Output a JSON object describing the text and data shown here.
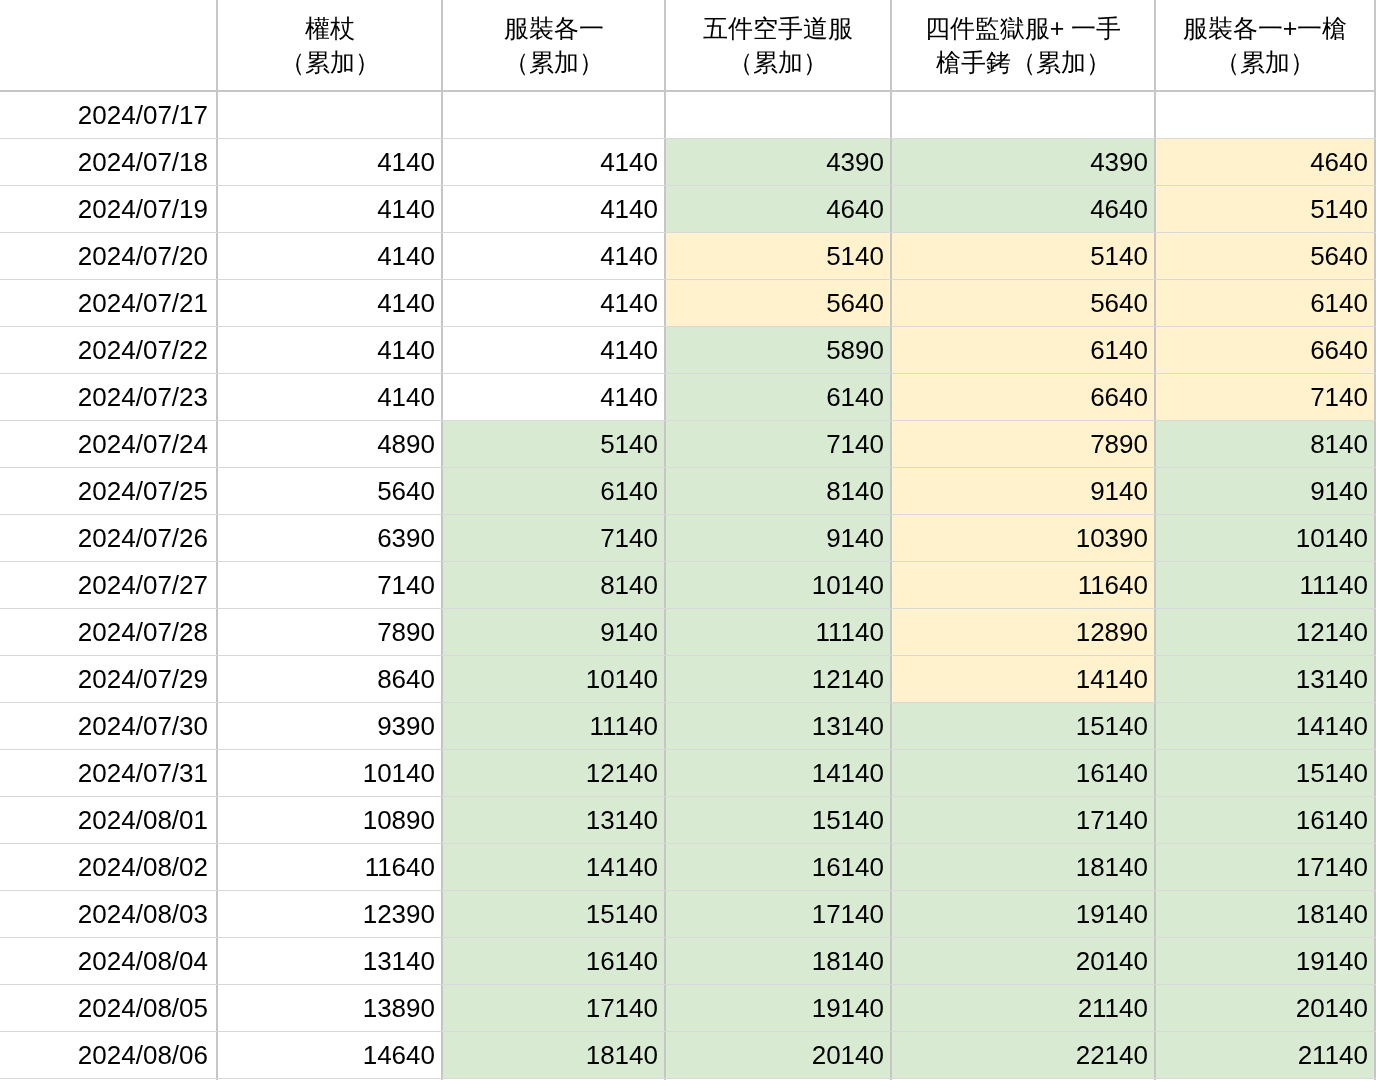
{
  "columns": [
    {
      "lines": [
        "權杖",
        "（累加）"
      ]
    },
    {
      "lines": [
        "服裝各一",
        "（累加）"
      ]
    },
    {
      "lines": [
        "五件空手道服",
        "（累加）"
      ]
    },
    {
      "lines": [
        "四件監獄服+ 一手",
        "槍手銬（累加）"
      ]
    },
    {
      "lines": [
        "服裝各一+一槍",
        "（累加）"
      ]
    }
  ],
  "rows": [
    {
      "date": "2024/07/17",
      "cells": [
        {},
        {},
        {},
        {},
        {}
      ]
    },
    {
      "date": "2024/07/18",
      "cells": [
        {
          "value": "4140"
        },
        {
          "value": "4140"
        },
        {
          "value": "4390",
          "color": "#d9ead3"
        },
        {
          "value": "4390",
          "color": "#d9ead3"
        },
        {
          "value": "4640",
          "color": "#fff2cc"
        }
      ]
    },
    {
      "date": "2024/07/19",
      "cells": [
        {
          "value": "4140"
        },
        {
          "value": "4140"
        },
        {
          "value": "4640",
          "color": "#d9ead3"
        },
        {
          "value": "4640",
          "color": "#d9ead3"
        },
        {
          "value": "5140",
          "color": "#fff2cc"
        }
      ]
    },
    {
      "date": "2024/07/20",
      "cells": [
        {
          "value": "4140"
        },
        {
          "value": "4140"
        },
        {
          "value": "5140",
          "color": "#fff2cc"
        },
        {
          "value": "5140",
          "color": "#fff2cc"
        },
        {
          "value": "5640",
          "color": "#fff2cc"
        }
      ]
    },
    {
      "date": "2024/07/21",
      "cells": [
        {
          "value": "4140"
        },
        {
          "value": "4140"
        },
        {
          "value": "5640",
          "color": "#fff2cc"
        },
        {
          "value": "5640",
          "color": "#fff2cc"
        },
        {
          "value": "6140",
          "color": "#fff2cc"
        }
      ]
    },
    {
      "date": "2024/07/22",
      "cells": [
        {
          "value": "4140"
        },
        {
          "value": "4140"
        },
        {
          "value": "5890",
          "color": "#d9ead3"
        },
        {
          "value": "6140",
          "color": "#fff2cc"
        },
        {
          "value": "6640",
          "color": "#fff2cc"
        }
      ]
    },
    {
      "date": "2024/07/23",
      "cells": [
        {
          "value": "4140"
        },
        {
          "value": "4140"
        },
        {
          "value": "6140",
          "color": "#d9ead3"
        },
        {
          "value": "6640",
          "color": "#fff2cc"
        },
        {
          "value": "7140",
          "color": "#fff2cc"
        }
      ]
    },
    {
      "date": "2024/07/24",
      "cells": [
        {
          "value": "4890"
        },
        {
          "value": "5140",
          "color": "#d9ead3"
        },
        {
          "value": "7140",
          "color": "#d9ead3"
        },
        {
          "value": "7890",
          "color": "#fff2cc"
        },
        {
          "value": "8140",
          "color": "#d9ead3"
        }
      ]
    },
    {
      "date": "2024/07/25",
      "cells": [
        {
          "value": "5640"
        },
        {
          "value": "6140",
          "color": "#d9ead3"
        },
        {
          "value": "8140",
          "color": "#d9ead3"
        },
        {
          "value": "9140",
          "color": "#fff2cc"
        },
        {
          "value": "9140",
          "color": "#d9ead3"
        }
      ]
    },
    {
      "date": "2024/07/26",
      "cells": [
        {
          "value": "6390"
        },
        {
          "value": "7140",
          "color": "#d9ead3"
        },
        {
          "value": "9140",
          "color": "#d9ead3"
        },
        {
          "value": "10390",
          "color": "#fff2cc"
        },
        {
          "value": "10140",
          "color": "#d9ead3"
        }
      ]
    },
    {
      "date": "2024/07/27",
      "cells": [
        {
          "value": "7140"
        },
        {
          "value": "8140",
          "color": "#d9ead3"
        },
        {
          "value": "10140",
          "color": "#d9ead3"
        },
        {
          "value": "11640",
          "color": "#fff2cc"
        },
        {
          "value": "11140",
          "color": "#d9ead3"
        }
      ]
    },
    {
      "date": "2024/07/28",
      "cells": [
        {
          "value": "7890"
        },
        {
          "value": "9140",
          "color": "#d9ead3"
        },
        {
          "value": "11140",
          "color": "#d9ead3"
        },
        {
          "value": "12890",
          "color": "#fff2cc"
        },
        {
          "value": "12140",
          "color": "#d9ead3"
        }
      ]
    },
    {
      "date": "2024/07/29",
      "cells": [
        {
          "value": "8640"
        },
        {
          "value": "10140",
          "color": "#d9ead3"
        },
        {
          "value": "12140",
          "color": "#d9ead3"
        },
        {
          "value": "14140",
          "color": "#fff2cc"
        },
        {
          "value": "13140",
          "color": "#d9ead3"
        }
      ]
    },
    {
      "date": "2024/07/30",
      "cells": [
        {
          "value": "9390"
        },
        {
          "value": "11140",
          "color": "#d9ead3"
        },
        {
          "value": "13140",
          "color": "#d9ead3"
        },
        {
          "value": "15140",
          "color": "#d9ead3"
        },
        {
          "value": "14140",
          "color": "#d9ead3"
        }
      ]
    },
    {
      "date": "2024/07/31",
      "cells": [
        {
          "value": "10140"
        },
        {
          "value": "12140",
          "color": "#d9ead3"
        },
        {
          "value": "14140",
          "color": "#d9ead3"
        },
        {
          "value": "16140",
          "color": "#d9ead3"
        },
        {
          "value": "15140",
          "color": "#d9ead3"
        }
      ]
    },
    {
      "date": "2024/08/01",
      "cells": [
        {
          "value": "10890"
        },
        {
          "value": "13140",
          "color": "#d9ead3"
        },
        {
          "value": "15140",
          "color": "#d9ead3"
        },
        {
          "value": "17140",
          "color": "#d9ead3"
        },
        {
          "value": "16140",
          "color": "#d9ead3"
        }
      ]
    },
    {
      "date": "2024/08/02",
      "cells": [
        {
          "value": "11640"
        },
        {
          "value": "14140",
          "color": "#d9ead3"
        },
        {
          "value": "16140",
          "color": "#d9ead3"
        },
        {
          "value": "18140",
          "color": "#d9ead3"
        },
        {
          "value": "17140",
          "color": "#d9ead3"
        }
      ]
    },
    {
      "date": "2024/08/03",
      "cells": [
        {
          "value": "12390"
        },
        {
          "value": "15140",
          "color": "#d9ead3"
        },
        {
          "value": "17140",
          "color": "#d9ead3"
        },
        {
          "value": "19140",
          "color": "#d9ead3"
        },
        {
          "value": "18140",
          "color": "#d9ead3"
        }
      ]
    },
    {
      "date": "2024/08/04",
      "cells": [
        {
          "value": "13140"
        },
        {
          "value": "16140",
          "color": "#d9ead3"
        },
        {
          "value": "18140",
          "color": "#d9ead3"
        },
        {
          "value": "20140",
          "color": "#d9ead3"
        },
        {
          "value": "19140",
          "color": "#d9ead3"
        }
      ]
    },
    {
      "date": "2024/08/05",
      "cells": [
        {
          "value": "13890"
        },
        {
          "value": "17140",
          "color": "#d9ead3"
        },
        {
          "value": "19140",
          "color": "#d9ead3"
        },
        {
          "value": "21140",
          "color": "#d9ead3"
        },
        {
          "value": "20140",
          "color": "#d9ead3"
        }
      ]
    },
    {
      "date": "2024/08/06",
      "cells": [
        {
          "value": "14640"
        },
        {
          "value": "18140",
          "color": "#d9ead3"
        },
        {
          "value": "20140",
          "color": "#d9ead3"
        },
        {
          "value": "22140",
          "color": "#d9ead3"
        },
        {
          "value": "21140",
          "color": "#d9ead3"
        }
      ]
    }
  ]
}
